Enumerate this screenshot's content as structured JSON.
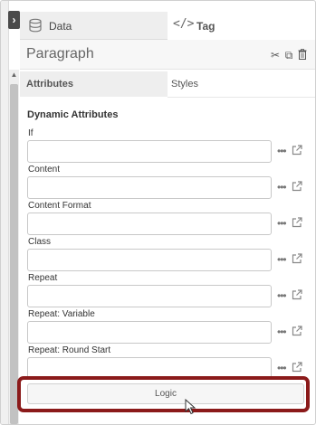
{
  "tabs": {
    "data_label": "Data",
    "tag_label": "Tag"
  },
  "title": {
    "text": "Paragraph"
  },
  "subtabs": {
    "attributes_label": "Attributes",
    "styles_label": "Styles"
  },
  "section": {
    "title": "Dynamic Attributes"
  },
  "fields": [
    {
      "label": "If",
      "value": ""
    },
    {
      "label": "Content",
      "value": ""
    },
    {
      "label": "Content Format",
      "value": ""
    },
    {
      "label": "Class",
      "value": ""
    },
    {
      "label": "Repeat",
      "value": ""
    },
    {
      "label": "Repeat: Variable",
      "value": ""
    },
    {
      "label": "Repeat: Round Start",
      "value": ""
    }
  ],
  "field_more_glyph": "•••",
  "logic_button": {
    "label": "Logic"
  },
  "colors": {
    "highlight": "#8b1a1a",
    "collapse_button": "#4a4a4a"
  },
  "icons": {
    "collapse": "chevron-right-icon",
    "data": "database-icon",
    "tag": "code-icon",
    "cut": "scissors-icon",
    "copy": "copy-icon",
    "delete": "trash-icon",
    "more": "ellipsis-icon",
    "external": "external-link-icon",
    "cursor": "mouse-pointer-icon"
  }
}
